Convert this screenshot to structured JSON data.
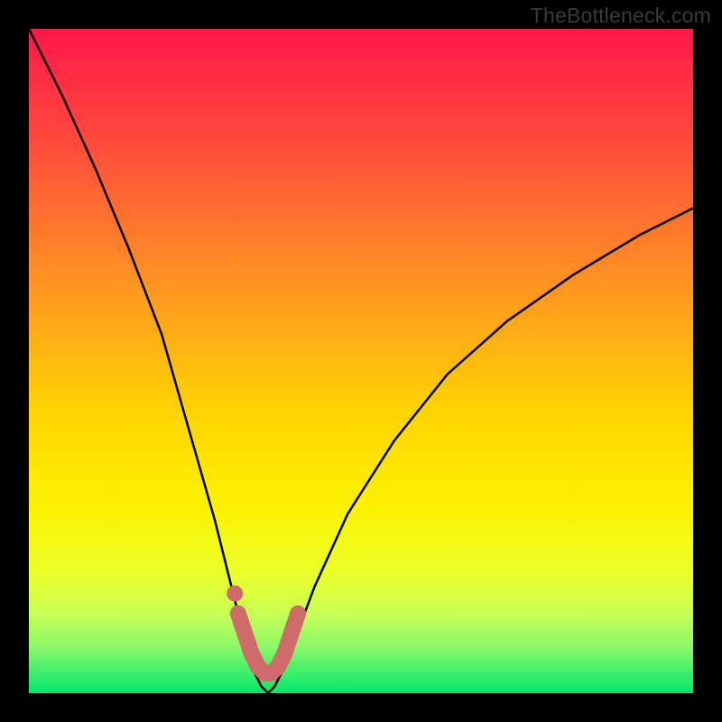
{
  "watermark": "TheBottleneck.com",
  "chart_data": {
    "type": "line",
    "title": "",
    "xlabel": "",
    "ylabel": "",
    "xlim": [
      0,
      100
    ],
    "ylim": [
      0,
      100
    ],
    "grid": false,
    "legend": false,
    "gradient_background": {
      "top_color": "#ff184a",
      "mid_color": "#fded00",
      "bottom_color": "#00e86a",
      "description": "vertical red-to-yellow-to-green gradient; red=high bottleneck, green=low"
    },
    "series": [
      {
        "name": "bottleneck-curve",
        "x": [
          0,
          5,
          10,
          15,
          20,
          24,
          28,
          31,
          33,
          34,
          35,
          36,
          37,
          38,
          40,
          43,
          48,
          55,
          63,
          72,
          82,
          92,
          100
        ],
        "y": [
          100,
          90,
          79,
          67,
          54,
          40,
          26,
          14,
          6,
          3,
          1,
          0,
          1,
          3,
          8,
          16,
          27,
          38,
          48,
          56,
          63,
          69,
          73
        ],
        "color": "#000000"
      },
      {
        "name": "highlight-segment",
        "x": [
          31.5,
          32.5,
          33.5,
          34.5,
          35.5,
          36.5,
          37.5,
          38.5,
          39.5,
          40.5
        ],
        "y": [
          12,
          9,
          6,
          4,
          3,
          3,
          4,
          6,
          9,
          12
        ],
        "color": "#cf6b6b",
        "description": "thick salmon segment near the curve minimum"
      }
    ],
    "markers": [
      {
        "name": "left-dot",
        "x": 31.0,
        "y": 15,
        "color": "#cf6b6b"
      }
    ],
    "annotations": []
  }
}
